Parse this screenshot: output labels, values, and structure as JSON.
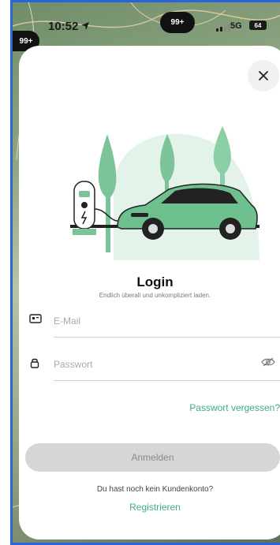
{
  "status_bar": {
    "time": "10:52",
    "center_badge": "99+",
    "left_badge": "99+",
    "network": "5G",
    "battery": "64"
  },
  "login": {
    "title": "Login",
    "subtitle": "Endlich überall und unkompliziert laden.",
    "email_placeholder": "E-Mail",
    "password_placeholder": "Passwort",
    "forgot_password": "Passwort vergessen?",
    "login_button": "Anmelden",
    "no_account_text": "Du hast noch kein Kundenkonto?",
    "register_link": "Registrieren"
  },
  "icons": {
    "close": "close-icon",
    "email": "card-icon",
    "password": "lock-icon",
    "toggle_visibility": "eye-off-icon",
    "location": "location-arrow-icon"
  },
  "colors": {
    "accent": "#3fae7c",
    "button_disabled": "#d6d6d6",
    "frame_border": "#2b63d9"
  }
}
